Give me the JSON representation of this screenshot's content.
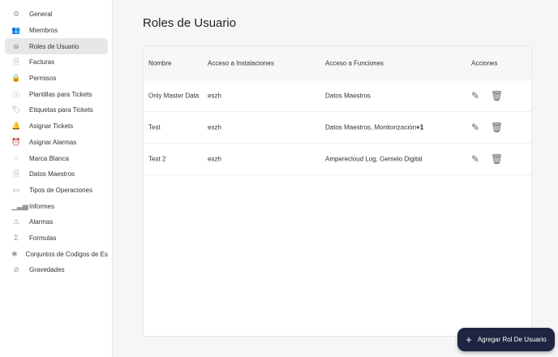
{
  "sidebar": {
    "items": [
      {
        "label": "General",
        "icon": "settings-icon",
        "glyph": "⚙"
      },
      {
        "label": "Miembros",
        "icon": "users-icon",
        "glyph": "👥"
      },
      {
        "label": "Roles de Usuario",
        "icon": "user-circle-icon",
        "glyph": "☺",
        "selected": true
      },
      {
        "label": "Facturas",
        "icon": "invoice-icon",
        "glyph": "🗎"
      },
      {
        "label": "Permisos",
        "icon": "lock-icon",
        "glyph": "🔒"
      },
      {
        "label": "Plantillas para Tickets",
        "icon": "info-icon",
        "glyph": "ⓘ"
      },
      {
        "label": "Etiquetas para Tickets",
        "icon": "tag-icon",
        "glyph": "🏷"
      },
      {
        "label": "Asignar Tickets",
        "icon": "bell-icon",
        "glyph": "🔔"
      },
      {
        "label": "Asignar Alarmas",
        "icon": "alarm-icon",
        "glyph": "⏰"
      },
      {
        "label": "Marca Blanca",
        "icon": "grid-icon",
        "glyph": "⁘"
      },
      {
        "label": "Datos Maestros",
        "icon": "document-icon",
        "glyph": "🗎"
      },
      {
        "label": "Tipos de Operaciones",
        "icon": "calendar-icon",
        "glyph": "▭"
      },
      {
        "label": "Informes",
        "icon": "bar-chart-icon",
        "glyph": "▁▃▅"
      },
      {
        "label": "Alarmas",
        "icon": "warning-icon",
        "glyph": "⚠"
      },
      {
        "label": "Formulas",
        "icon": "sigma-icon",
        "glyph": "Σ"
      },
      {
        "label": "Conjuntos de Codigos de Estado",
        "icon": "bug-icon",
        "glyph": "✱"
      },
      {
        "label": "Gravedades",
        "icon": "circle-slash-icon",
        "glyph": "⊘"
      }
    ]
  },
  "page": {
    "title": "Roles de Usuario"
  },
  "table": {
    "headers": [
      "Nombre",
      "Acceso a Instalaciones",
      "Acceso a Funciones",
      "Acciones"
    ],
    "rows": [
      {
        "nombre": "Only Master Data",
        "instalaciones": "eszh",
        "funciones": "Datos Maestros",
        "extra": ""
      },
      {
        "nombre": "Test",
        "instalaciones": "eszh",
        "funciones": "Datos Maestros, Monitorización",
        "extra": "+1"
      },
      {
        "nombre": "Test 2",
        "instalaciones": "eszh",
        "funciones": "Amperecloud Log, Gemelo Digital",
        "extra": ""
      }
    ]
  },
  "fab": {
    "label": "Agregar Rol De Usuario",
    "icon": "plus-icon"
  },
  "colors": {
    "fab": "#1f2541",
    "selected": "#e7e7ea"
  }
}
